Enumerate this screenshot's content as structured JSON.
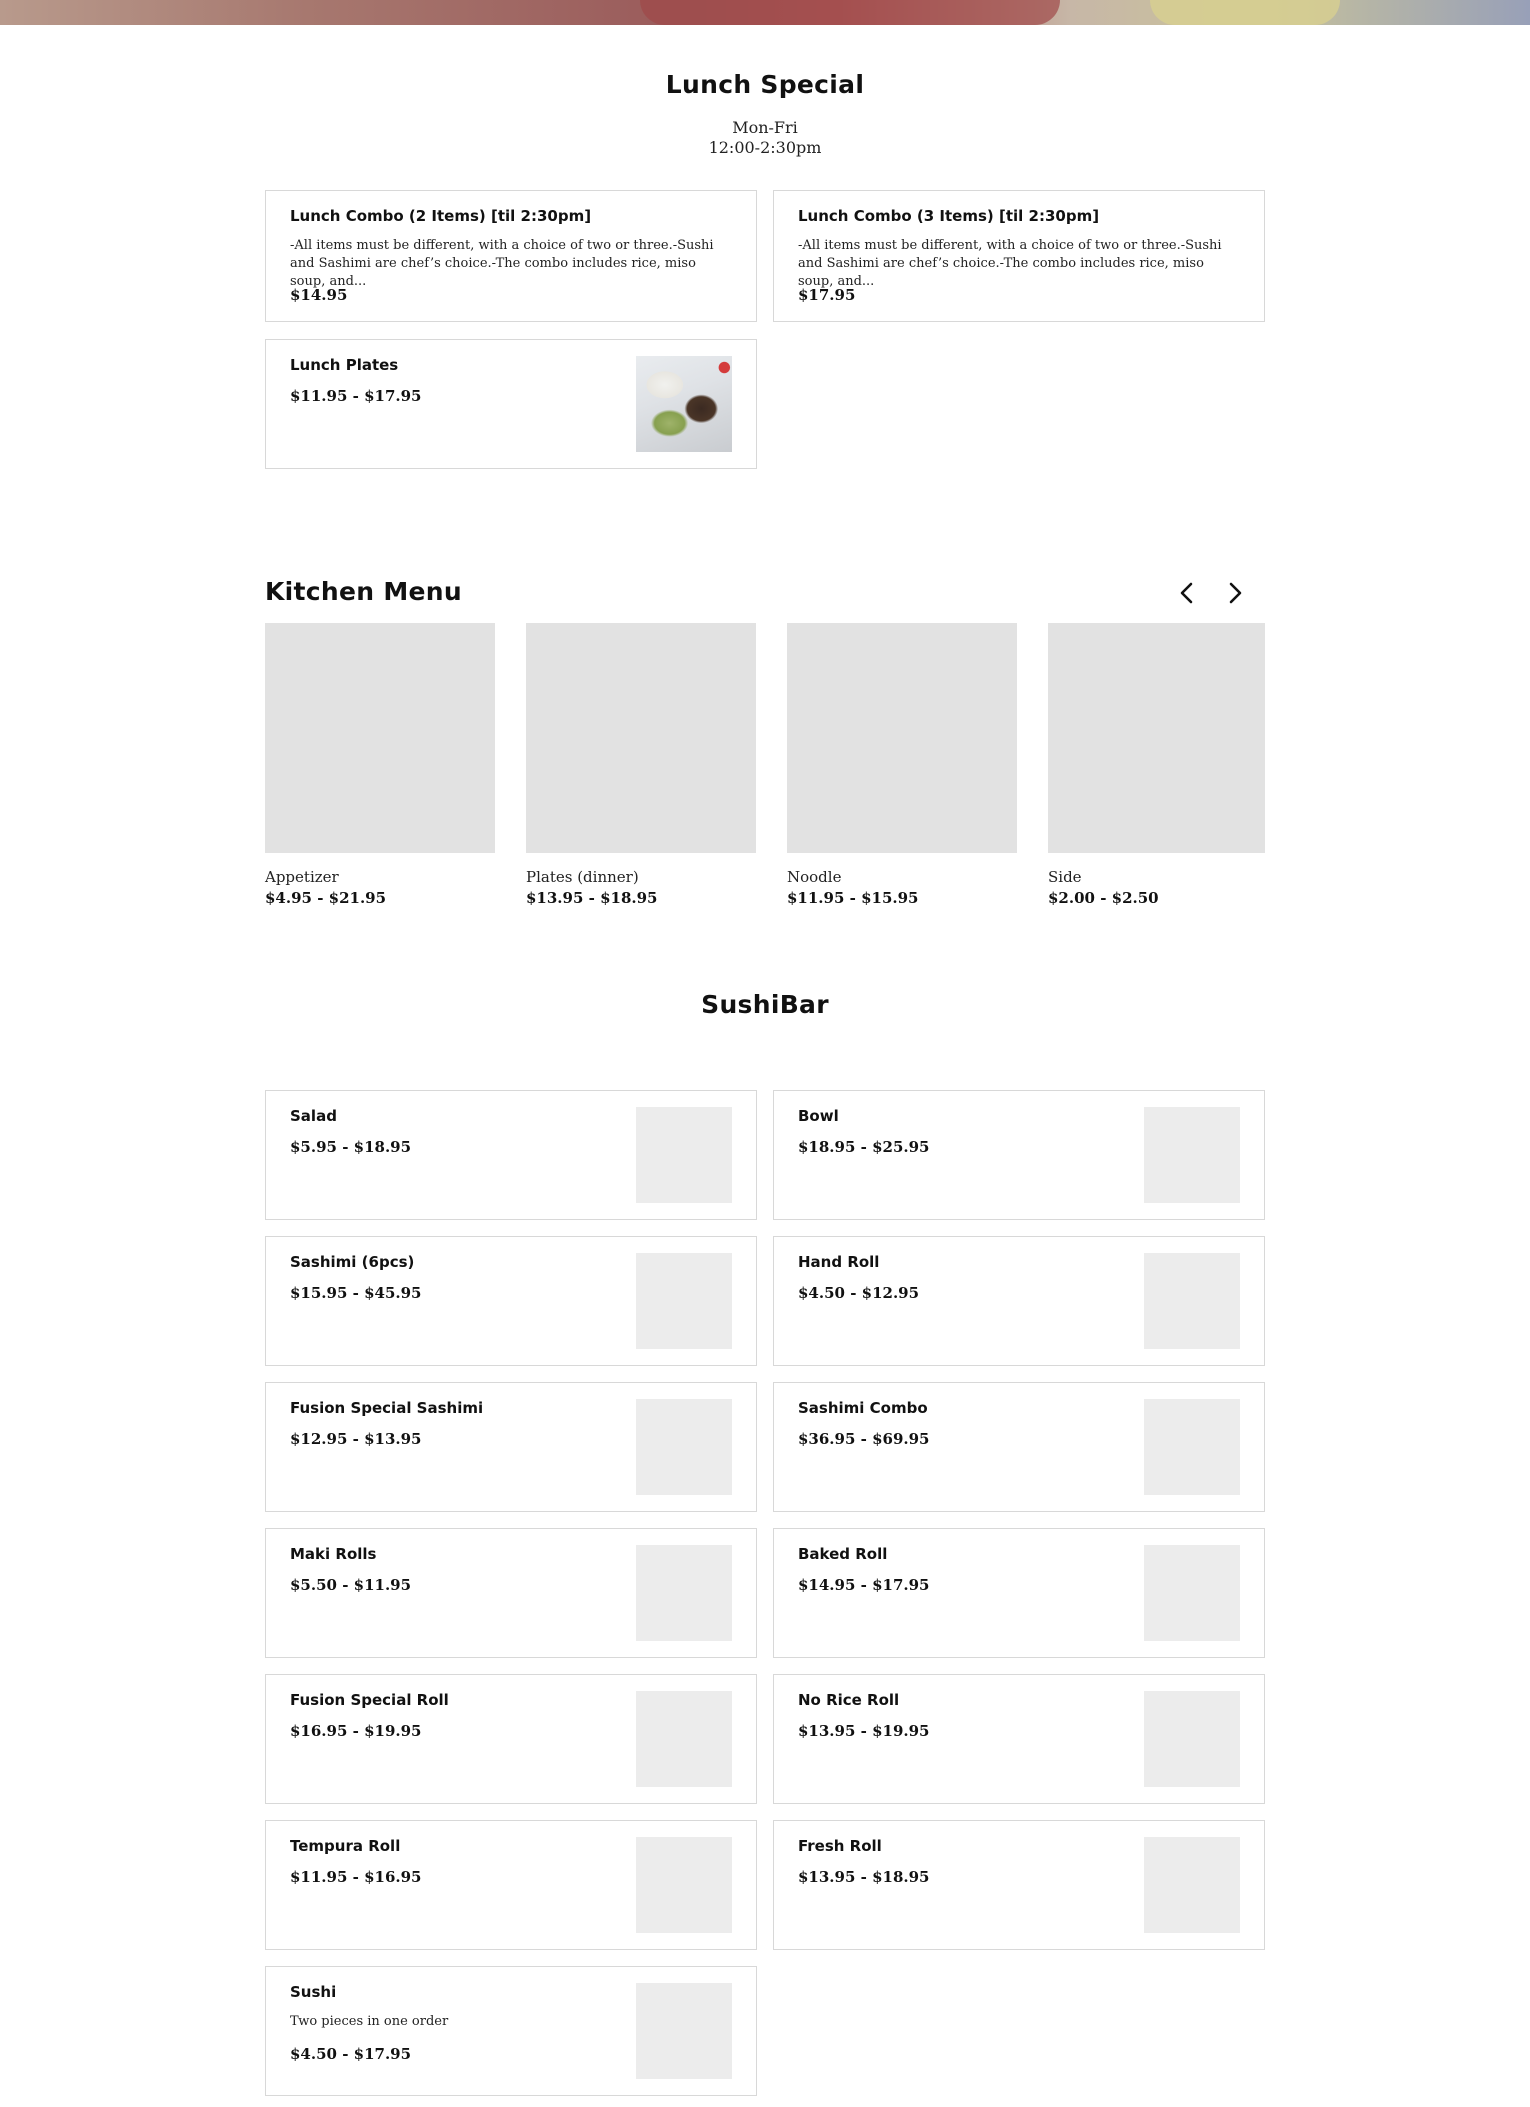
{
  "lunch": {
    "title": "Lunch Special",
    "days": "Mon-Fri",
    "hours": "12:00-2:30pm",
    "items": [
      {
        "name": "Lunch Combo (2 Items) [til 2:30pm]",
        "desc": "-All items must be different, with a choice of two or three.-Sushi and Sashimi are chef’s choice.-The combo includes rice, miso soup, and...",
        "price": "$14.95"
      },
      {
        "name": "Lunch Combo (3 Items) [til 2:30pm]",
        "desc": "-All items must be different, with a choice of two or three.-Sushi and Sashimi are chef’s choice.-The combo includes rice, miso soup, and...",
        "price": "$17.95"
      },
      {
        "name": "Lunch Plates",
        "price": "$11.95 - $17.95",
        "image": "food-photo"
      }
    ]
  },
  "kitchen": {
    "title": "Kitchen Menu",
    "prev_icon": "chevron-left-icon",
    "next_icon": "chevron-right-icon",
    "items": [
      {
        "name": "Appetizer",
        "price": "$4.95 - $21.95"
      },
      {
        "name": "Plates (dinner)",
        "price": "$13.95 - $18.95"
      },
      {
        "name": "Noodle",
        "price": "$11.95 - $15.95"
      },
      {
        "name": "Side",
        "price": "$2.00 - $2.50"
      }
    ]
  },
  "sushibar": {
    "title": "SushiBar",
    "items": [
      {
        "name": "Salad",
        "price": "$5.95 - $18.95"
      },
      {
        "name": "Bowl",
        "price": "$18.95 - $25.95"
      },
      {
        "name": "Sashimi (6pcs)",
        "price": "$15.95 - $45.95"
      },
      {
        "name": "Hand Roll",
        "price": "$4.50 - $12.95"
      },
      {
        "name": "Fusion Special Sashimi",
        "price": "$12.95 - $13.95"
      },
      {
        "name": "Sashimi Combo",
        "price": "$36.95 - $69.95"
      },
      {
        "name": "Maki Rolls",
        "price": "$5.50 - $11.95"
      },
      {
        "name": "Baked Roll",
        "price": "$14.95 - $17.95"
      },
      {
        "name": "Fusion Special Roll",
        "price": "$16.95 - $19.95"
      },
      {
        "name": "No Rice Roll",
        "price": "$13.95 - $19.95"
      },
      {
        "name": "Tempura Roll",
        "price": "$11.95 - $16.95"
      },
      {
        "name": "Fresh Roll",
        "price": "$13.95 - $18.95"
      },
      {
        "name": "Sushi",
        "desc": "Two pieces in one order",
        "price": "$4.50 - $17.95"
      }
    ]
  },
  "colors": {
    "card_border": "#d8d8d8",
    "placeholder": "#e2e2e2",
    "thumb_placeholder": "#ececec",
    "text": "#111111"
  }
}
